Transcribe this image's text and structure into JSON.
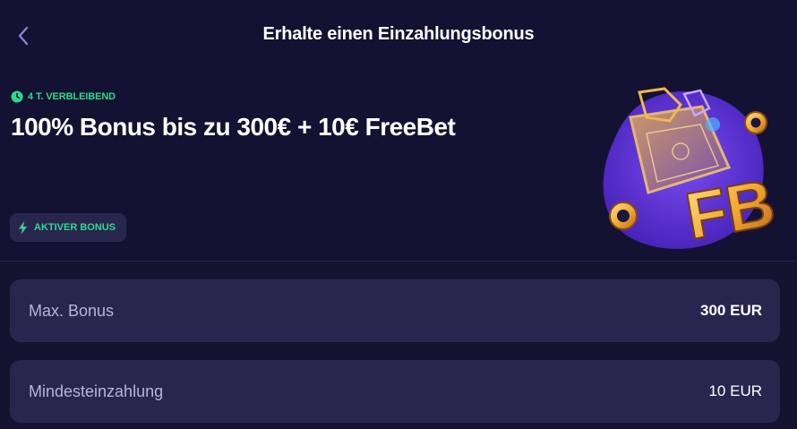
{
  "header": {
    "title": "Erhalte einen Einzahlungsbonus"
  },
  "bonus": {
    "remaining": "4 T. VERBLEIBEND",
    "title": "100% Bonus bis zu 300€ + 10€ FreeBet",
    "status_badge": "AKTIVER BONUS",
    "art_letters": "FB"
  },
  "details": [
    {
      "label": "Max. Bonus",
      "value": "300 EUR"
    },
    {
      "label": "Mindesteinzahlung",
      "value": "10 EUR"
    }
  ],
  "colors": {
    "background": "#15132f",
    "card": "#28264f",
    "accent_green": "#2fd98b",
    "art_purple": "#5b2fd6"
  }
}
